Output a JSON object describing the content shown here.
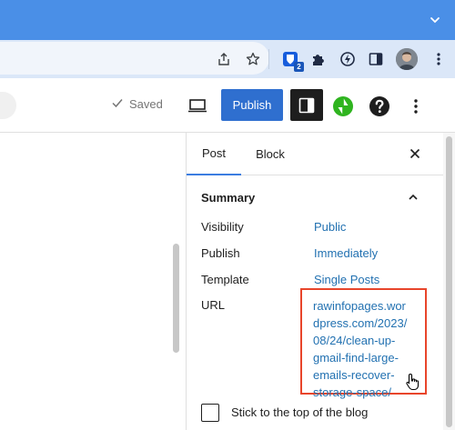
{
  "colors": {
    "browser_accent": "#4a8fe7",
    "toolbar_bg": "#dbe7f8",
    "publish_blue": "#2f6fcf",
    "link_blue": "#2271b1",
    "highlight_red": "#e8452b",
    "jetpack_green": "#2fb41f"
  },
  "browser": {
    "tabstrip_icon": "chevron-down-icon",
    "toolbar_icons": [
      "share-icon",
      "bookmark-star-icon",
      "bitwarden-extension-icon",
      "puzzle-extensions-icon",
      "bolt-extension-icon",
      "side-panel-icon",
      "profile-avatar",
      "kebab-menu-icon"
    ],
    "extension_badge": "2"
  },
  "header": {
    "saved_label": "Saved",
    "publish_label": "Publish",
    "icons": [
      "check-icon",
      "desktop-preview-icon",
      "settings-sidebar-icon",
      "jetpack-icon",
      "help-icon",
      "options-kebab-icon"
    ]
  },
  "sidebar": {
    "tabs": [
      {
        "label": "Post"
      },
      {
        "label": "Block"
      }
    ],
    "panel_title": "Summary",
    "rows": [
      {
        "label": "Visibility",
        "value": "Public"
      },
      {
        "label": "Publish",
        "value": "Immediately"
      },
      {
        "label": "Template",
        "value": "Single Posts"
      },
      {
        "label": "URL",
        "value": "rawinfopages.wordpress.com/2023/08/24/clean-up-gmail-find-large-emails-recover-storage-space/"
      }
    ],
    "url_lines": [
      "rawinfopages.wor",
      "dpress.com/2023/",
      "08/24/clean-up-",
      "gmail-find-large-",
      "emails-recover-",
      "storage-space/"
    ],
    "sticky_label": "Stick to the top of the blog"
  }
}
